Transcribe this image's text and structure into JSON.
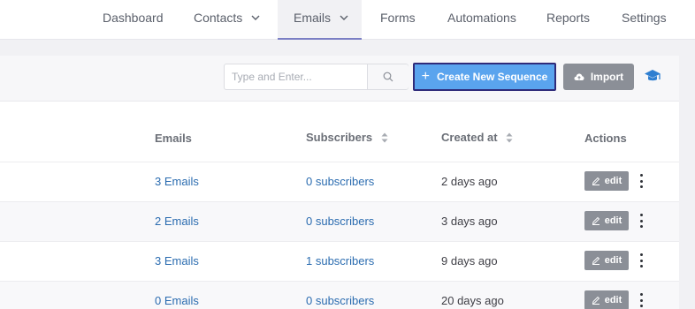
{
  "nav": {
    "items": [
      {
        "label": "Dashboard"
      },
      {
        "label": "Contacts"
      },
      {
        "label": "Emails"
      },
      {
        "label": "Forms"
      },
      {
        "label": "Automations"
      },
      {
        "label": "Reports"
      },
      {
        "label": "Settings"
      }
    ],
    "active": "Emails"
  },
  "toolbar": {
    "search_placeholder": "Type and Enter...",
    "create_label": "Create New Sequence",
    "import_label": "Import"
  },
  "table": {
    "headers": {
      "emails": "Emails",
      "subscribers": "Subscribers",
      "created_at": "Created at",
      "actions": "Actions"
    },
    "edit_label": "edit",
    "rows": [
      {
        "emails": "3 Emails",
        "subscribers": "0 subscribers",
        "created": "2 days ago"
      },
      {
        "emails": "2 Emails",
        "subscribers": "0 subscribers",
        "created": "3 days ago"
      },
      {
        "emails": "3 Emails",
        "subscribers": "1 subscribers",
        "created": "9 days ago"
      },
      {
        "emails": "0 Emails",
        "subscribers": "0 subscribers",
        "created": "20 days ago"
      }
    ]
  },
  "colors": {
    "accent": "#5aa4ee",
    "link": "#2b6cb0",
    "button_gray": "#8b8f97"
  }
}
